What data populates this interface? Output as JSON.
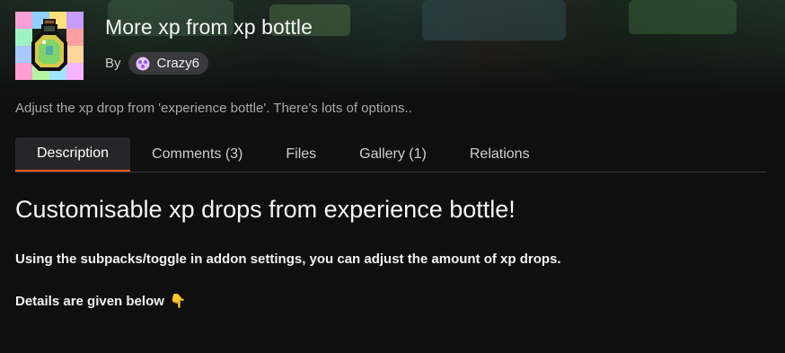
{
  "project": {
    "title": "More xp from xp bottle",
    "by_label": "By",
    "author": "Crazy6",
    "summary": "Adjust the xp drop from 'experience bottle'. There's lots of options.."
  },
  "tabs": [
    {
      "label": "Description",
      "active": true
    },
    {
      "label": "Comments (3)",
      "active": false
    },
    {
      "label": "Files",
      "active": false
    },
    {
      "label": "Gallery (1)",
      "active": false
    },
    {
      "label": "Relations",
      "active": false
    }
  ],
  "description": {
    "heading": "Customisable xp drops from experience bottle!",
    "paragraph1": "Using the subpacks/toggle in addon settings, you can adjust the amount of xp drops.",
    "paragraph2": "Details are given below",
    "paragraph2_emoji": "👇"
  },
  "icons": {
    "project_avatar": "xp-bottle-icon",
    "author_avatar": "author-avatar-icon"
  },
  "colors": {
    "accent": "#f05a28",
    "background": "#0f0f10",
    "tab_active_bg": "#262628"
  }
}
